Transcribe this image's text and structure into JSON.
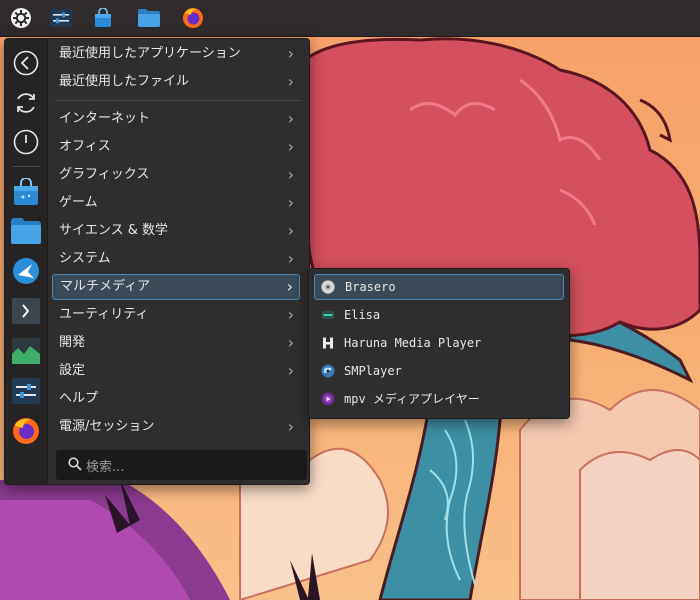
{
  "panel": {
    "items": [
      {
        "icon": "application-launcher-icon"
      },
      {
        "icon": "system-settings-icon"
      },
      {
        "icon": "software-store-icon"
      },
      {
        "icon": "file-manager-icon"
      },
      {
        "icon": "firefox-icon"
      }
    ]
  },
  "favorites": [
    {
      "icon": "back-arrow-icon"
    },
    {
      "icon": "refresh-icon"
    },
    {
      "icon": "power-icon"
    },
    {
      "icon": "software-store-icon"
    },
    {
      "icon": "file-manager-icon"
    },
    {
      "icon": "discover-icon"
    },
    {
      "icon": "terminal-icon"
    },
    {
      "icon": "system-monitor-icon"
    },
    {
      "icon": "system-settings-icon"
    },
    {
      "icon": "firefox-icon"
    }
  ],
  "menu": {
    "recent_apps": "最近使用したアプリケーション",
    "recent_files": "最近使用したファイル",
    "categories": [
      {
        "label": "インターネット",
        "has_submenu": true
      },
      {
        "label": "オフィス",
        "has_submenu": true
      },
      {
        "label": "グラフィックス",
        "has_submenu": true
      },
      {
        "label": "ゲーム",
        "has_submenu": true
      },
      {
        "label": "サイエンス & 数学",
        "has_submenu": true
      },
      {
        "label": "システム",
        "has_submenu": true
      },
      {
        "label": "マルチメディア",
        "has_submenu": true,
        "selected": true
      },
      {
        "label": "ユーティリティ",
        "has_submenu": true
      },
      {
        "label": "開発",
        "has_submenu": true
      },
      {
        "label": "設定",
        "has_submenu": true
      },
      {
        "label": "ヘルプ",
        "has_submenu": false
      },
      {
        "label": "電源/セッション",
        "has_submenu": true
      }
    ],
    "search_placeholder": "検索..."
  },
  "submenu": {
    "items": [
      {
        "label": "Brasero",
        "icon": "disc-burner-icon",
        "selected": true
      },
      {
        "label": "Elisa",
        "icon": "music-player-icon"
      },
      {
        "label": "Haruna Media Player",
        "icon": "video-player-icon"
      },
      {
        "label": "SMPlayer",
        "icon": "smplayer-icon"
      },
      {
        "label": "mpv メディアプレイヤー",
        "icon": "mpv-icon"
      }
    ]
  },
  "colors": {
    "panel_bg": "#2f2b2c",
    "menu_bg": "#302d2e",
    "highlight_border": "#4d87b2",
    "highlight_bg": "#3a4a58"
  }
}
